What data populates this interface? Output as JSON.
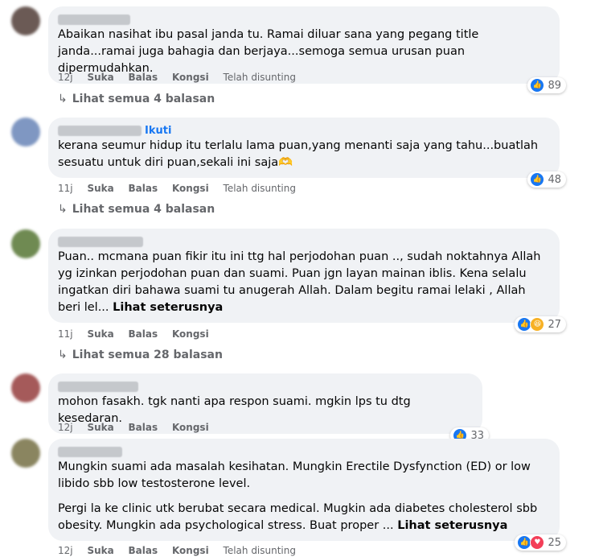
{
  "comments": [
    {
      "text": [
        "Abaikan nasihat ibu pasal janda tu. Ramai diluar sana yang pegang title janda...ramai juga bahagia dan berjaya...semoga semua urusan puan dipermudahkan."
      ],
      "reaction_count": "89",
      "time": "12j",
      "like": "Suka",
      "reply": "Balas",
      "share": "Kongsi",
      "edited": "Telah disunting",
      "replies": "Lihat semua 4 balasan",
      "avatar_color": "#6b5a55"
    },
    {
      "follow": "Ikuti",
      "text": [
        "kerana seumur hidup itu terlalu lama puan,yang menanti saja yang tahu...buatlah sesuatu untuk diri puan,sekali ini saja"
      ],
      "emoji": "🫶",
      "reaction_count": "48",
      "time": "11j",
      "like": "Suka",
      "reply": "Balas",
      "share": "Kongsi",
      "edited": "Telah disunting",
      "replies": "Lihat semua 4 balasan",
      "avatar_color": "#7f97c2"
    },
    {
      "text": [
        "Puan.. mcmana puan fikir itu ini ttg hal perjodohan puan .., sudah noktahnya Allah yg izinkan perjodohan puan dan suami. Puan jgn layan mainan iblis. Kena selalu ingatkan diri bahawa suami tu anugerah Allah. Dalam begitu ramai lelaki , Allah beri lel..."
      ],
      "see_more": "Lihat seterusnya",
      "reaction_count": "27",
      "time": "11j",
      "like": "Suka",
      "reply": "Balas",
      "share": "Kongsi",
      "replies": "Lihat semua 28 balasan",
      "avatar_color": "#6f8a52"
    },
    {
      "text": [
        "mohon fasakh. tgk nanti apa respon suami. mgkin lps tu dtg kesedaran."
      ],
      "reaction_count": "33",
      "time": "12j",
      "like": "Suka",
      "reply": "Balas",
      "share": "Kongsi",
      "avatar_color": "#a55a5a"
    },
    {
      "text": [
        "Mungkin suami ada masalah kesihatan. Mungkin Erectile Dysfynction (ED) or low libido sbb low testosterone level.",
        "Pergi la ke clinic utk berubat secara medical. Mugkin ada diabetes cholesterol sbb obesity. Mungkin ada psychological stress. Buat proper ..."
      ],
      "see_more": "Lihat seterusnya",
      "reaction_count": "25",
      "time": "12j",
      "like": "Suka",
      "reply": "Balas",
      "share": "Kongsi",
      "edited": "Telah disunting",
      "avatar_color": "#8a8560"
    }
  ],
  "icons": [
    "like-icon",
    "haha-icon",
    "love-icon",
    "reply-arrow-icon"
  ]
}
